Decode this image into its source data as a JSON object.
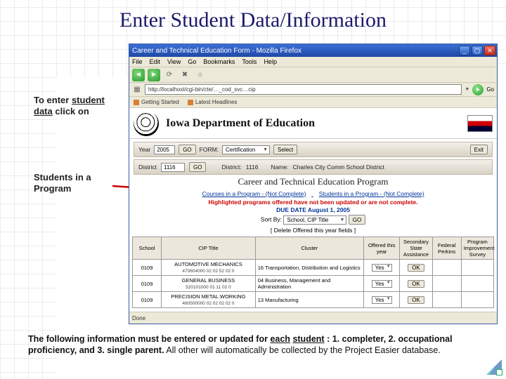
{
  "slide": {
    "title": "Enter Student Data/Information",
    "note1_a": "To enter ",
    "note1_b": "student data",
    "note1_c": " click on",
    "note2": "Students in a Program",
    "footer_lead": "The following information must be entered or updated for ",
    "footer_each": "each",
    "footer_student": "student",
    "footer_mid": ": 1. completer, 2. occupational proficiency, and 3. single parent.",
    "footer_tail": "  All other will automatically be collected by the Project Easier database."
  },
  "browser": {
    "title": "Career and Technical Education Form - Mozilla Firefox",
    "menu": [
      "File",
      "Edit",
      "View",
      "Go",
      "Bookmarks",
      "Tools",
      "Help"
    ],
    "address": "http://localhost/cgi-bin/cte/…_cod_svc…cip",
    "go": "Go",
    "bm1": "Getting Started",
    "bm2": "Latest Headlines",
    "status": "Done"
  },
  "page": {
    "banner_title": "Iowa Department of Education",
    "year_label": "Year",
    "year_value": "2005",
    "go_btn": "GO",
    "form_label": "FORM:",
    "form_sel": "Certification",
    "select_btn": "Select",
    "exit_btn": "Exit",
    "district_label": "District",
    "district_value": "1116",
    "district2_label": "District:",
    "district2_value": "1116",
    "name_label": "Name:",
    "name_value": "Charles City Comm School District",
    "cte_title": "Career and Technical Education Program",
    "link_courses": "Courses in a Program - (Not Complete)",
    "link_students": "Students in a Program - (Not Complete)",
    "highlight_a": "Highlighted programs",
    "highlight_b": " offered have not been updated or are not complete.",
    "due": "DUE DATE August 1, 2005",
    "sort_label": "Sort By:",
    "sort_value": "School, CIP Title",
    "bracket": "[ Delete Offered this year fields ]",
    "table": {
      "headers": [
        "School",
        "CIP Title",
        "Cluster",
        "Offered this year",
        "Secondary State Assistance",
        "Federal Perkins",
        "Program Improvement Survey"
      ],
      "rows": [
        {
          "school": "0109",
          "cip": "AUTOMOTIVE MECHANICS",
          "cipnum": "470604000 02 02 52 02 0",
          "cluster": "16 Transportation, Distribution and Logistics",
          "offered": "Yes"
        },
        {
          "school": "0109",
          "cip": "GENERAL BUSINESS",
          "cipnum": "520101000 01 11 02 0",
          "cluster": "04 Business, Management and Administration",
          "offered": "Yes"
        },
        {
          "school": "0109",
          "cip": "PRECISION METAL WORKING",
          "cipnum": "480500000 02 02 02 02 0",
          "cluster": "13 Manufacturing",
          "offered": "Yes"
        }
      ],
      "ok": "OK"
    }
  }
}
